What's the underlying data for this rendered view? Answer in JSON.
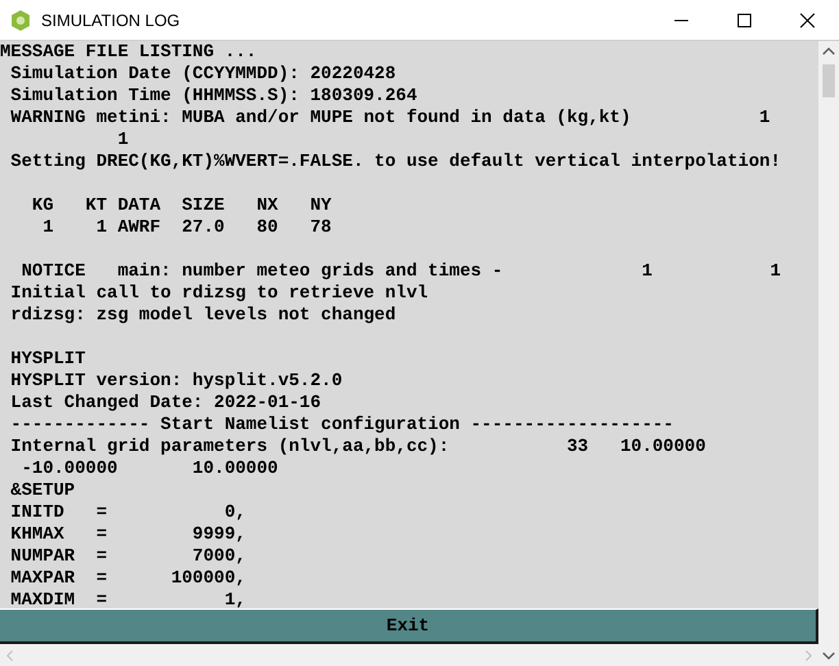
{
  "window": {
    "title": "SIMULATION LOG"
  },
  "log": {
    "blocks": [
      [
        "MESSAGE FILE LISTING ...",
        " Simulation Date (CCYYMMDD): 20220428",
        " Simulation Time (HHMMSS.S): 180309.264",
        " WARNING metini: MUBA and/or MUPE not found in data (kg,kt)            1",
        "           1",
        " Setting DREC(KG,KT)%WVERT=.FALSE. to use default vertical interpolation!"
      ],
      [
        "   KG   KT DATA  SIZE   NX   NY",
        "    1    1 AWRF  27.0   80   78"
      ],
      [
        "  NOTICE   main: number meteo grids and times -             1           1",
        " Initial call to rdizsg to retrieve nlvl",
        " rdizsg: zsg model levels not changed"
      ],
      [
        " HYSPLIT",
        " HYSPLIT version: hysplit.v5.2.0",
        " Last Changed Date: 2022-01-16",
        " ------------- Start Namelist configuration -------------------",
        " Internal grid parameters (nlvl,aa,bb,cc):           33   10.00000",
        "  -10.00000       10.00000",
        " &SETUP",
        " INITD   =           0,",
        " KHMAX   =        9999,",
        " NUMPAR  =        7000,",
        " MAXPAR  =      100000,",
        " MAXDIM  =           1,"
      ]
    ]
  },
  "exit_button": {
    "label": "Exit"
  }
}
